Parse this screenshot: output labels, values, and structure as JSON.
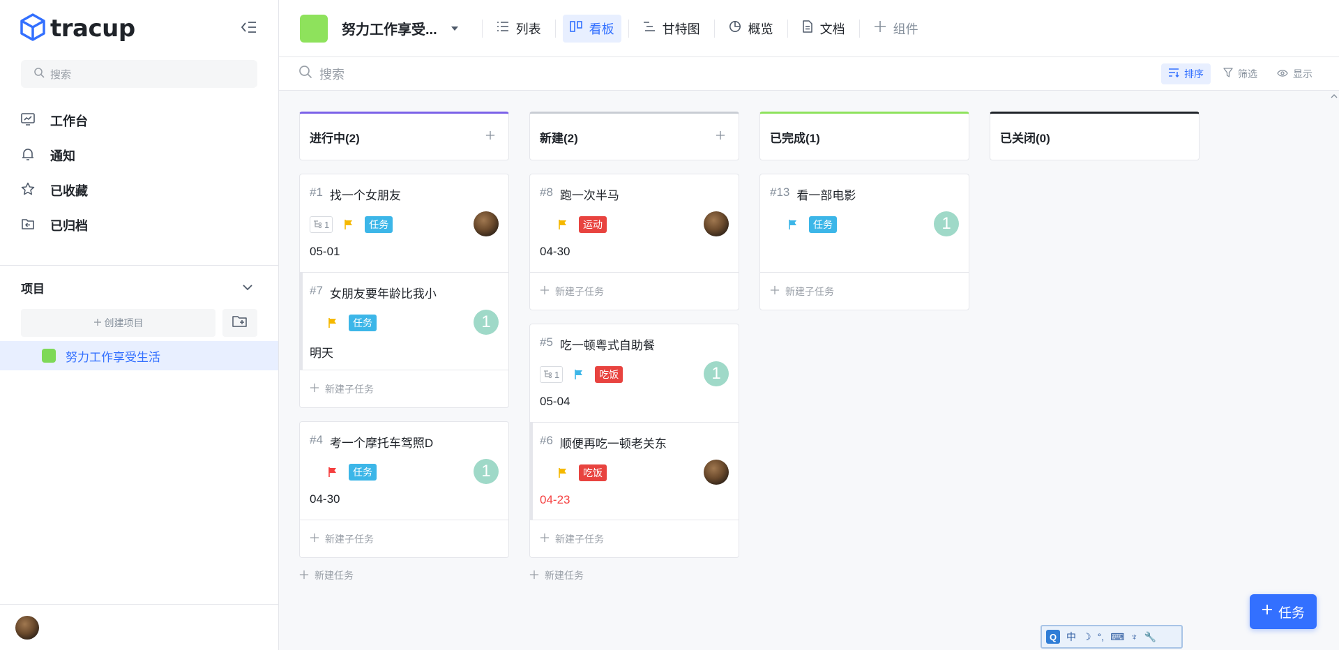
{
  "sidebar": {
    "logo_text": "tracup",
    "search_placeholder": "搜索",
    "nav": [
      {
        "label": "工作台",
        "icon": "dashboard-icon"
      },
      {
        "label": "通知",
        "icon": "bell-icon"
      },
      {
        "label": "已收藏",
        "icon": "star-icon"
      },
      {
        "label": "已归档",
        "icon": "archive-icon"
      }
    ],
    "projects_heading": "项目",
    "create_project_label": "创建项目",
    "projects": [
      {
        "name": "努力工作享受生活",
        "color": "#7ed957"
      }
    ]
  },
  "topbar": {
    "project_title": "努力工作享受...",
    "project_color": "#8ee25c",
    "views": [
      {
        "label": "列表",
        "icon": "list-icon",
        "active": false
      },
      {
        "label": "看板",
        "icon": "kanban-icon",
        "active": true
      },
      {
        "label": "甘特图",
        "icon": "gantt-icon",
        "active": false
      },
      {
        "label": "概览",
        "icon": "pie-chart-icon",
        "active": false
      },
      {
        "label": "文档",
        "icon": "document-icon",
        "active": false
      }
    ],
    "add_component_label": "组件"
  },
  "toolbar": {
    "search_placeholder": "搜索",
    "sort_label": "排序",
    "filter_label": "筛选",
    "display_label": "显示"
  },
  "board": {
    "add_subtask_label": "新建子任务",
    "add_task_label": "新建任务",
    "columns": [
      {
        "title": "进行中(2)",
        "accent": "#7b61e8",
        "has_add": true,
        "groups": [
          [
            {
              "num": "#1",
              "title": "找一个女朋友",
              "subcount": "1",
              "flag": "#f5b800",
              "tag": "任务",
              "tag_color": "#3cb6e8",
              "date": "05-01",
              "overdue": false,
              "assignee": "avatar",
              "count": ""
            },
            {
              "num": "#7",
              "title": "女朋友要年龄比我小",
              "subcount": "",
              "flag": "#f5b800",
              "tag": "任务",
              "tag_color": "#3cb6e8",
              "date": "明天",
              "overdue": false,
              "assignee": "count",
              "count": "1",
              "sub": true
            }
          ],
          [
            {
              "num": "#4",
              "title": "考一个摩托车驾照D",
              "subcount": "",
              "flag": "#f53f3f",
              "tag": "任务",
              "tag_color": "#3cb6e8",
              "date": "04-30",
              "overdue": false,
              "assignee": "count",
              "count": "1"
            }
          ]
        ],
        "show_add_task": true
      },
      {
        "title": "新建(2)",
        "accent": "#c9cdd4",
        "has_add": true,
        "groups": [
          [
            {
              "num": "#8",
              "title": "跑一次半马",
              "subcount": "",
              "flag": "#f5b800",
              "tag": "运动",
              "tag_color": "#e8433f",
              "date": "04-30",
              "overdue": false,
              "assignee": "avatar",
              "count": ""
            }
          ],
          [
            {
              "num": "#5",
              "title": "吃一顿粤式自助餐",
              "subcount": "1",
              "flag": "#3cb6e8",
              "tag": "吃饭",
              "tag_color": "#e8433f",
              "date": "05-04",
              "overdue": false,
              "assignee": "count",
              "count": "1"
            },
            {
              "num": "#6",
              "title": "顺便再吃一顿老关东",
              "subcount": "",
              "flag": "#f5b800",
              "tag": "吃饭",
              "tag_color": "#e8433f",
              "date": "04-23",
              "overdue": true,
              "assignee": "avatar",
              "count": "",
              "sub": true
            }
          ]
        ],
        "show_add_task": true
      },
      {
        "title": "已完成(1)",
        "accent": "#8ee25c",
        "has_add": false,
        "groups": [
          [
            {
              "num": "#13",
              "title": "看一部电影",
              "subcount": "",
              "flag": "#3cb6e8",
              "tag": "任务",
              "tag_color": "#3cb6e8",
              "date": "",
              "overdue": false,
              "assignee": "count",
              "count": "1"
            }
          ]
        ],
        "show_add_task": false
      },
      {
        "title": "已关闭(0)",
        "accent": "#1f2329",
        "has_add": false,
        "groups": [],
        "show_add_task": false
      }
    ]
  },
  "fab_label": "任务",
  "ime": {
    "items": [
      "中",
      "☽",
      "°,",
      "⌨",
      "♆",
      "🔧"
    ],
    "logo": "Q"
  }
}
